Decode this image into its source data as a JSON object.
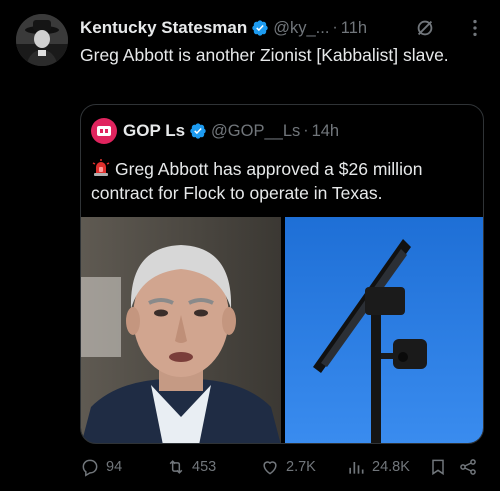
{
  "post": {
    "author_name": "Kentucky Statesman",
    "handle": "@ky_...",
    "separator": "·",
    "time": "11h",
    "text": "Greg Abbott is another Zionist [Kabbalist] slave."
  },
  "quoted": {
    "author_name": "GOP Ls",
    "handle": "@GOP__Ls",
    "separator": "·",
    "time": "14h",
    "text": "Greg Abbott has approved a $26 million contract for Flock to operate in Texas."
  },
  "actions": {
    "replies": "94",
    "reposts": "453",
    "likes": "2.7K",
    "views": "24.8K"
  },
  "colors": {
    "background": "#000000",
    "text": "#e7e9ea",
    "muted": "#71767b",
    "verified": "#1d9bf0",
    "border": "#2f3336"
  },
  "icons": [
    "verified-badge-icon",
    "grok-icon",
    "more-icon",
    "siren-icon",
    "reply-icon",
    "repost-icon",
    "like-icon",
    "views-icon",
    "bookmark-icon",
    "share-icon"
  ]
}
